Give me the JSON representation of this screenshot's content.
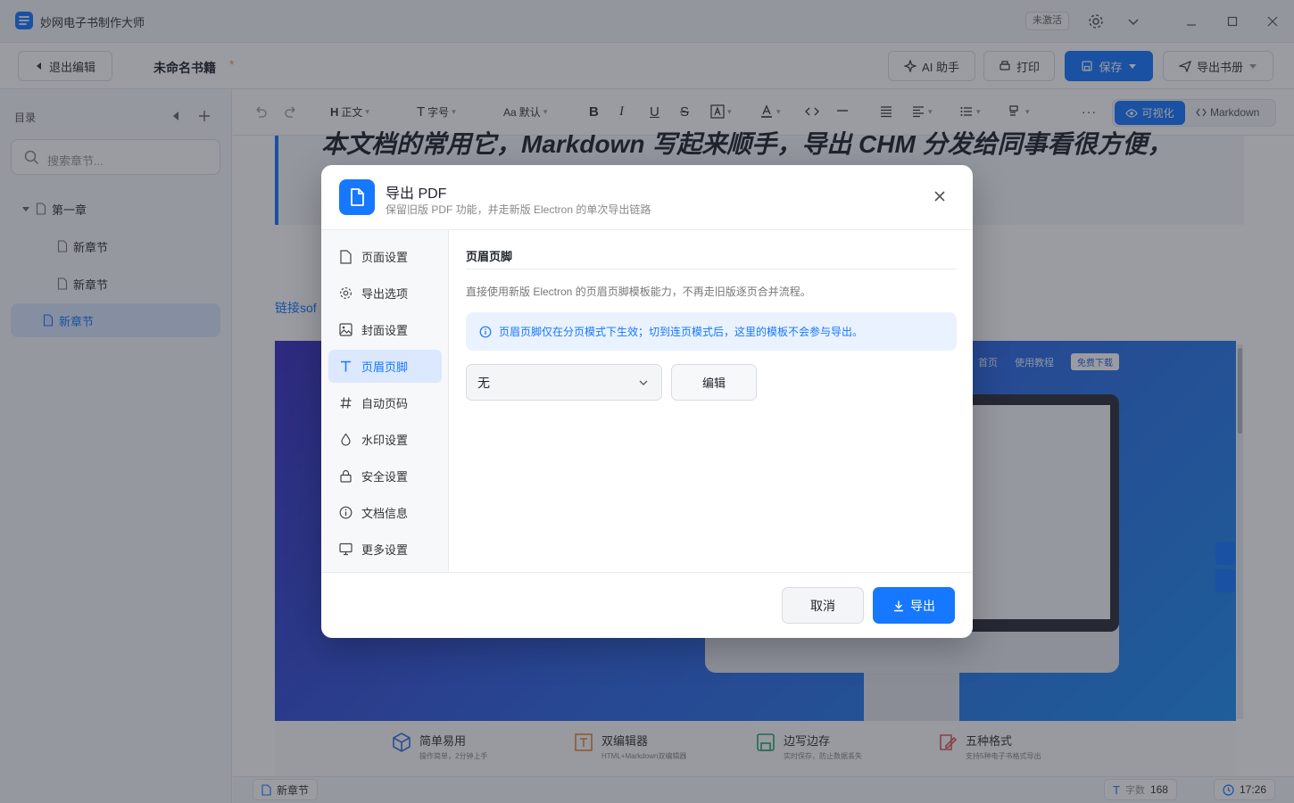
{
  "window": {
    "title": "妙网电子书制作大师",
    "activation_badge": "未激活"
  },
  "toolbar": {
    "exit_label": "退出编辑",
    "doc_title": "未命名书籍",
    "unsaved_marker": "*",
    "ai_label": "AI 助手",
    "print_label": "打印",
    "save_label": "保存",
    "export_book_label": "导出书册"
  },
  "sidebar": {
    "title": "目录",
    "search_placeholder": "搜索章节...",
    "chapters": [
      {
        "label": "第一章"
      },
      {
        "label": "新章节"
      },
      {
        "label": "新章节"
      },
      {
        "label": "新章节"
      }
    ]
  },
  "format_bar": {
    "heading_label": "正文",
    "size_label": "字号",
    "font_label": "默认",
    "view_visual": "可视化",
    "view_markdown": "Markdown"
  },
  "editor": {
    "quote_text": "本文档的常用它，Markdown 写起来顺手，导出 CHM 分发给同事看很方便，",
    "link_text": "链接sof",
    "banner_nav": [
      "首页",
      "使用教程"
    ],
    "banner_download": "免费下载",
    "features": [
      {
        "title": "简单易用",
        "sub": "操作简单，2分钟上手",
        "color": "#3a6fe0"
      },
      {
        "title": "双编辑器",
        "sub": "HTML+Markdown双编辑器",
        "color": "#e08a3a"
      },
      {
        "title": "边写边存",
        "sub": "实时保存，防止数据丢失",
        "color": "#2aa56a"
      },
      {
        "title": "五种格式",
        "sub": "支持5种电子书格式导出",
        "color": "#e05a5a"
      }
    ]
  },
  "status": {
    "chapter": "新章节",
    "word_count_label": "字数",
    "word_count": "168",
    "time": "17:26"
  },
  "dialog": {
    "title": "导出 PDF",
    "subtitle": "保留旧版 PDF 功能，并走新版 Electron 的单次导出链路",
    "nav": [
      {
        "label": "页面设置",
        "icon": "file-icon"
      },
      {
        "label": "导出选项",
        "icon": "gear-icon"
      },
      {
        "label": "封面设置",
        "icon": "image-icon"
      },
      {
        "label": "页眉页脚",
        "icon": "text-icon"
      },
      {
        "label": "自动页码",
        "icon": "hash-icon"
      },
      {
        "label": "水印设置",
        "icon": "droplet-icon"
      },
      {
        "label": "安全设置",
        "icon": "lock-icon"
      },
      {
        "label": "文档信息",
        "icon": "info-icon"
      },
      {
        "label": "更多设置",
        "icon": "monitor-icon"
      }
    ],
    "section_title": "页眉页脚",
    "section_desc": "直接使用新版 Electron 的页眉页脚模板能力，不再走旧版逐页合并流程。",
    "notice": "页眉页脚仅在分页模式下生效；切到连页模式后，这里的模板不会参与导出。",
    "template_value": "无",
    "edit_label": "编辑",
    "cancel_label": "取消",
    "export_label": "导出"
  },
  "colors": {
    "accent": "#1677ff"
  }
}
